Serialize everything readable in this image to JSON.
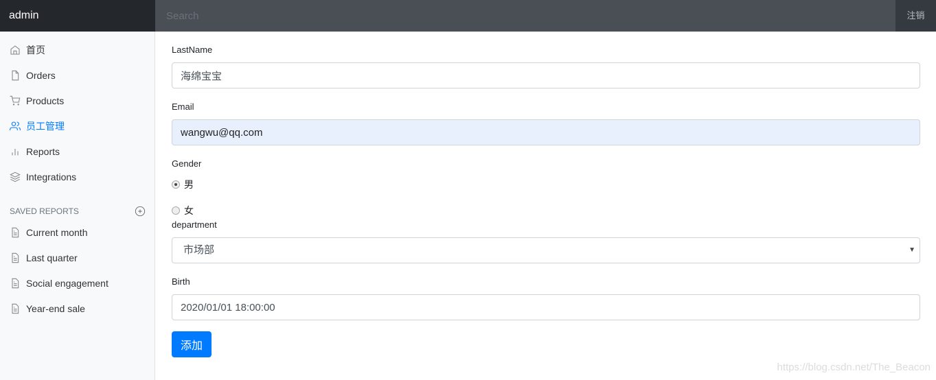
{
  "navbar": {
    "brand": "admin",
    "search_placeholder": "Search",
    "signout": "注销"
  },
  "sidebar": {
    "items": [
      {
        "label": "首页",
        "icon": "home-icon"
      },
      {
        "label": "Orders",
        "icon": "file-icon"
      },
      {
        "label": "Products",
        "icon": "shopping-cart-icon"
      },
      {
        "label": "员工管理",
        "icon": "users-icon",
        "active": true
      },
      {
        "label": "Reports",
        "icon": "bar-chart-icon"
      },
      {
        "label": "Integrations",
        "icon": "layers-icon"
      }
    ],
    "saved_heading": "SAVED REPORTS",
    "saved": [
      {
        "label": "Current month"
      },
      {
        "label": "Last quarter"
      },
      {
        "label": "Social engagement"
      },
      {
        "label": "Year-end sale"
      }
    ]
  },
  "form": {
    "lastname_label": "LastName",
    "lastname_value": "海绵宝宝",
    "email_label": "Email",
    "email_value": "wangwu@qq.com",
    "gender_label": "Gender",
    "gender_options": [
      "男",
      "女"
    ],
    "gender_selected": "男",
    "department_label": "department",
    "department_value": "市场部",
    "birth_label": "Birth",
    "birth_value": "2020/01/01 18:00:00",
    "submit": "添加"
  },
  "accent_color": "#007bff",
  "watermark": "https://blog.csdn.net/The_Beacon"
}
